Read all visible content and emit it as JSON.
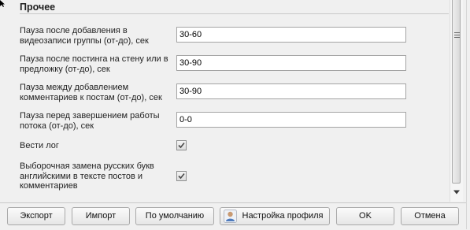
{
  "section": {
    "title": "Прочее"
  },
  "settings": {
    "pause_add_video": {
      "label": "Пауза после добавления в видеозаписи группы (от-до), сек",
      "value": "30-60"
    },
    "pause_post_wall": {
      "label": "Пауза после постинга на стену или в предложку (от-до), сек",
      "value": "30-90"
    },
    "pause_comments": {
      "label": "Пауза между добавлением комментариев к постам (от-до), сек",
      "value": "30-90"
    },
    "pause_finish": {
      "label": "Пауза перед завершением работы потока (от-до), сек",
      "value": "0-0"
    },
    "keep_log": {
      "label": "Вести лог",
      "checked": true
    },
    "replace_letters": {
      "label": "Выборочная замена русских букв английскими в тексте постов и комментариев",
      "checked": true
    }
  },
  "buttons": {
    "export": "Экспорт",
    "import": "Импорт",
    "defaults": "По умолчанию",
    "profile_settings": "Настройка профиля",
    "ok": "OK",
    "cancel": "Отмена"
  },
  "icons": {
    "checkmark": "checkmark-icon",
    "scroll_grip": "scroll-grip-icon",
    "scroll_down": "arrow-down-icon",
    "profile": "user-profile-icon"
  },
  "colors": {
    "background": "#f0f0f0",
    "field_border": "#a4a4a4",
    "button_border": "#a9a9a9",
    "checkmark": "#4a4a4a"
  }
}
